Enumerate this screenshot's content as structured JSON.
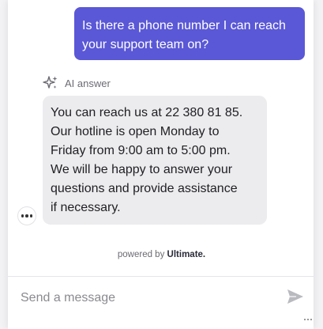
{
  "conversation": {
    "user_message": "Is there a phone number I can reach your support team on?",
    "ai_label": "AI answer",
    "ai_message_lines": [
      "You can reach us at 22 380 81 85.",
      "Our hotline is open Monday to",
      "Friday from 9:00 am to 5:00 pm.",
      "We will be happy to answer your",
      "questions and provide assistance",
      "if necessary."
    ]
  },
  "footer": {
    "powered_by": "powered by",
    "brand": "Ultimate."
  },
  "composer": {
    "placeholder": "Send a message",
    "value": ""
  },
  "icons": {
    "ai": "sparkles-icon",
    "more": "more-options-icon",
    "send": "send-icon"
  },
  "colors": {
    "user_bubble": "#5a58d6",
    "ai_bubble": "#ececee",
    "send_icon": "#b9b9c0"
  }
}
